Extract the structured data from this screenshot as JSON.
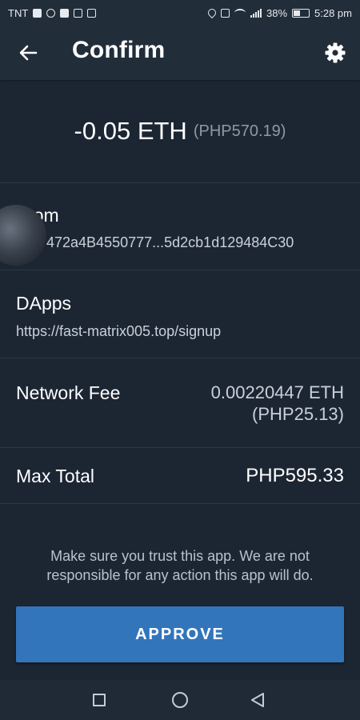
{
  "status_bar": {
    "carrier": "TNT",
    "battery_percent": "38%",
    "time": "5:28 pm"
  },
  "header": {
    "title": "Confirm",
    "back_icon": "arrow-left-icon",
    "settings_icon": "gear-icon"
  },
  "amount": {
    "value": "-0.05 ETH",
    "fiat": "(PHP570.19)"
  },
  "from": {
    "label": "From",
    "address": "472a4B4550777...5d2cb1d129484C30"
  },
  "dapps": {
    "label": "DApps",
    "url": "https://fast-matrix005.top/signup"
  },
  "network_fee": {
    "label": "Network Fee",
    "crypto": "0.00220447 ETH",
    "fiat": "(PHP25.13)"
  },
  "max_total": {
    "label": "Max Total",
    "value": "PHP595.33"
  },
  "warning": "Make sure you trust this app. We are not responsible for any action this app will do.",
  "approve_button": "APPROVE",
  "colors": {
    "background": "#1c2633",
    "header": "#222d3a",
    "button": "#3375bb"
  }
}
